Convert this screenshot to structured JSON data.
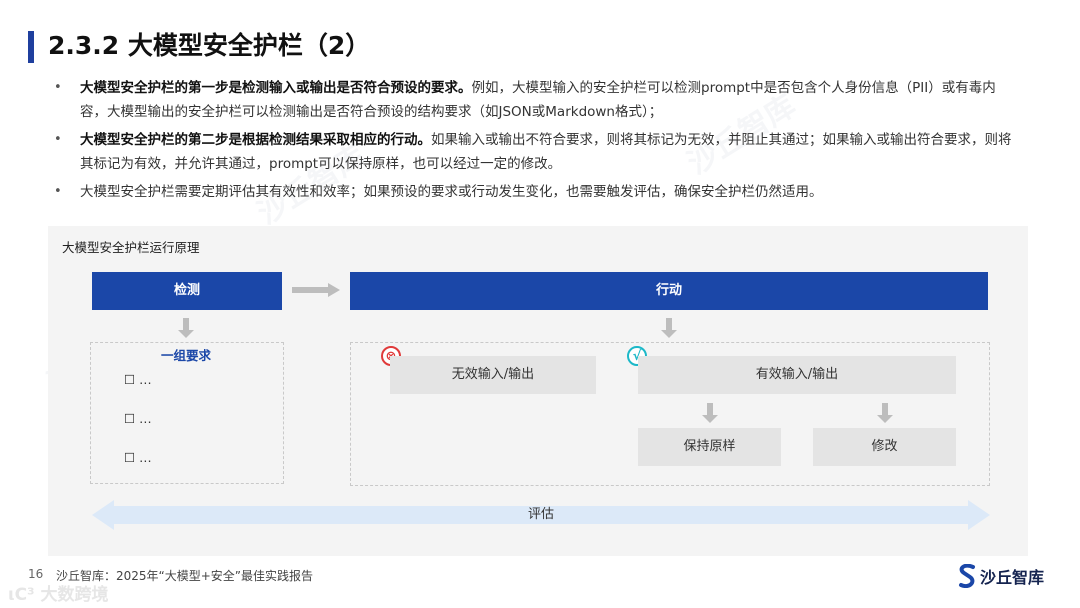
{
  "slide": {
    "title": "2.3.2 大模型安全护栏（2）"
  },
  "bullets": [
    {
      "bold": "大模型安全护栏的第一步是检测输入或输出是否符合预设的要求。",
      "text": "例如，大模型输入的安全护栏可以检测prompt中是否包含个人身份信息（PII）或有毒内容，大模型输出的安全护栏可以检测输出是否符合预设的结构要求（如JSON或Markdown格式）；"
    },
    {
      "bold": "大模型安全护栏的第二步是根据检测结果采取相应的行动。",
      "text": "如果输入或输出不符合要求，则将其标记为无效，并阻止其通过；如果输入或输出符合要求，则将其标记为有效，并允许其通过，prompt可以保持原样，也可以经过一定的修改。"
    },
    {
      "bold": "",
      "text": "大模型安全护栏需要定期评估其有效性和效率；如果预设的要求或行动发生变化，也需要触发评估，确保安全护栏仍然适用。"
    }
  ],
  "diagram": {
    "title": "大模型安全护栏运行原理",
    "detect_label": "检测",
    "action_label": "行动",
    "group_title": "一组要求",
    "requirements": [
      "☐ …",
      "☐ …",
      "☐ …"
    ],
    "invalid_label": "无效输入/输出",
    "valid_label": "有效输入/输出",
    "keep_label": "保持原样",
    "modify_label": "修改",
    "evaluate_label": "评估",
    "invalid_icon": "⊗",
    "valid_icon": "√"
  },
  "footer": {
    "page_number": "16",
    "source": "沙丘智库：2025年“大模型+安全”最佳实践报告",
    "bottom_mark": "ιC³ 大数跨境",
    "logo_text": "沙丘智库"
  },
  "watermark": {
    "text": "沙丘智库"
  },
  "colors": {
    "accent_blue": "#1b47a8",
    "title_bar": "#1f3f9e",
    "invalid_red": "#e03a3a",
    "valid_teal": "#1cb8c8",
    "eval_arrow": "#dce9f8"
  }
}
